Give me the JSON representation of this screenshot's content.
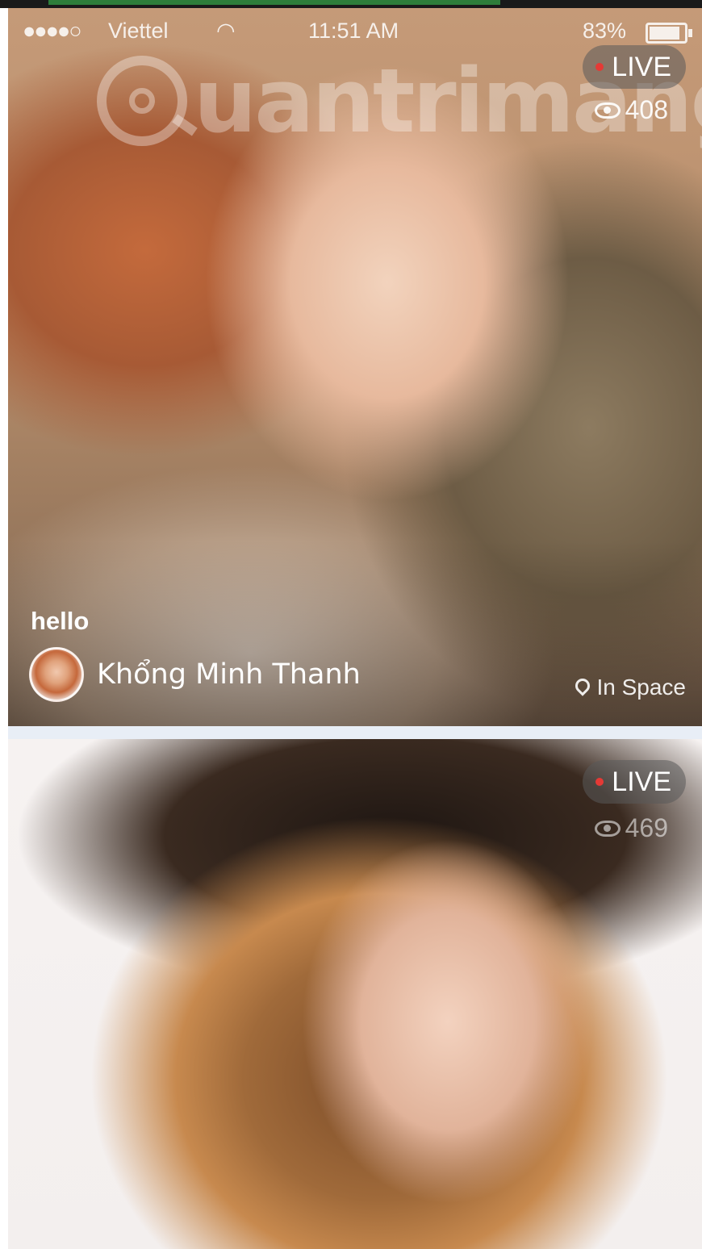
{
  "status_bar": {
    "signal": "●●●●○",
    "carrier": "Viettel",
    "wifi_symbol": "◠",
    "time": "11:51 AM",
    "battery": "83%"
  },
  "watermark": {
    "text": "uantrimang"
  },
  "feed": [
    {
      "live_label": "LIVE",
      "viewers": "408",
      "caption": "hello",
      "streamer_name": "Khổng Minh Thanh",
      "location": "In Space"
    },
    {
      "live_label": "LIVE",
      "viewers": "469"
    }
  ],
  "colors": {
    "live_dot": "#e53935",
    "divider": "#e8eef6"
  }
}
